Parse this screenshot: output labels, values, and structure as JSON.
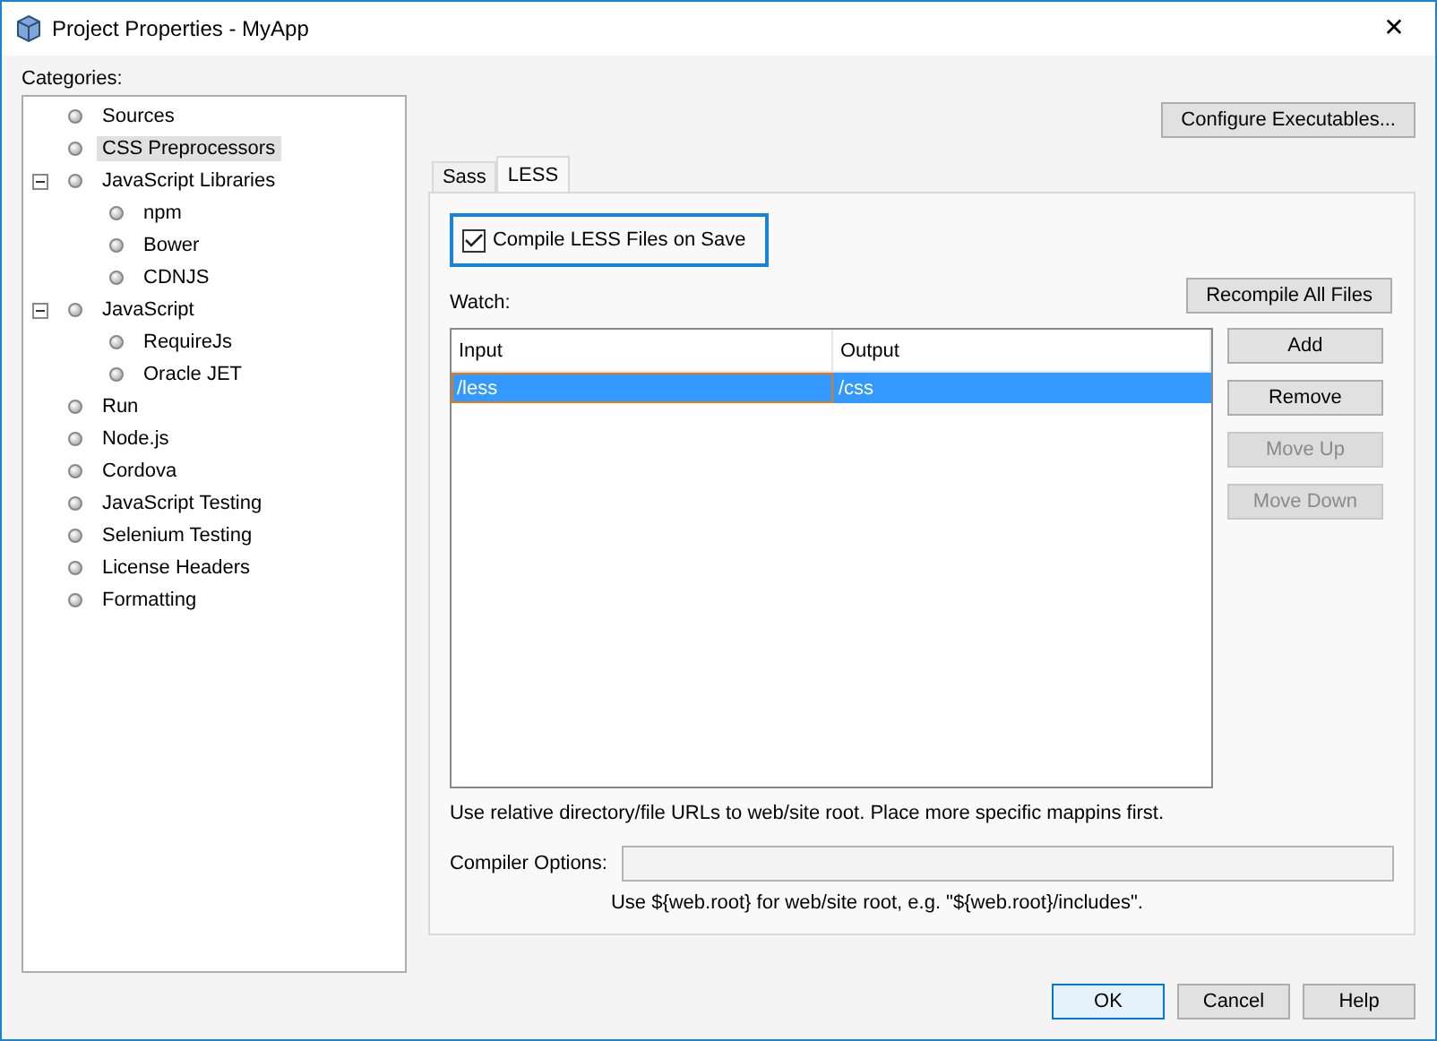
{
  "window": {
    "title": "Project Properties - MyApp",
    "close": "✕"
  },
  "categories": {
    "label": "Categories:",
    "items": [
      {
        "label": "Sources",
        "selected": false
      },
      {
        "label": "CSS Preprocessors",
        "selected": true
      },
      {
        "label": "JavaScript Libraries",
        "selected": false,
        "expanded": true,
        "children": [
          {
            "label": "npm",
            "selected": false
          },
          {
            "label": "Bower",
            "selected": false
          },
          {
            "label": "CDNJS",
            "selected": false
          }
        ]
      },
      {
        "label": "JavaScript",
        "selected": false,
        "expanded": true,
        "children": [
          {
            "label": "RequireJs",
            "selected": false
          },
          {
            "label": "Oracle JET",
            "selected": false
          }
        ]
      },
      {
        "label": "Run",
        "selected": false
      },
      {
        "label": "Node.js",
        "selected": false
      },
      {
        "label": "Cordova",
        "selected": false
      },
      {
        "label": "JavaScript Testing",
        "selected": false
      },
      {
        "label": "Selenium Testing",
        "selected": false
      },
      {
        "label": "License Headers",
        "selected": false
      },
      {
        "label": "Formatting",
        "selected": false
      }
    ]
  },
  "configure_button": "Configure Executables...",
  "tabs": [
    {
      "label": "Sass",
      "selected": false
    },
    {
      "label": "LESS",
      "selected": true
    }
  ],
  "compile_checkbox": {
    "label": "Compile LESS Files on Save",
    "checked": true,
    "focused": true
  },
  "watch_label": "Watch:",
  "recompile_button": "Recompile All Files",
  "table": {
    "columns": [
      "Input",
      "Output"
    ],
    "rows": [
      {
        "cells": [
          "/less",
          "/css"
        ],
        "selected": true
      }
    ]
  },
  "side_buttons": [
    {
      "label": "Add",
      "disabled": false
    },
    {
      "label": "Remove",
      "disabled": false
    },
    {
      "label": "Move Up",
      "disabled": true
    },
    {
      "label": "Move Down",
      "disabled": true
    }
  ],
  "hint": "Use relative directory/file URLs to web/site root. Place more specific mappins first.",
  "compiler_options": {
    "label": "Compiler Options:",
    "hint": "Use ${web.root} for web/site root, e.g. \"${web.root}/includes\"."
  },
  "footer_buttons": [
    {
      "label": "OK",
      "default": true
    },
    {
      "label": "Cancel",
      "default": false
    },
    {
      "label": "Help",
      "default": false
    }
  ]
}
